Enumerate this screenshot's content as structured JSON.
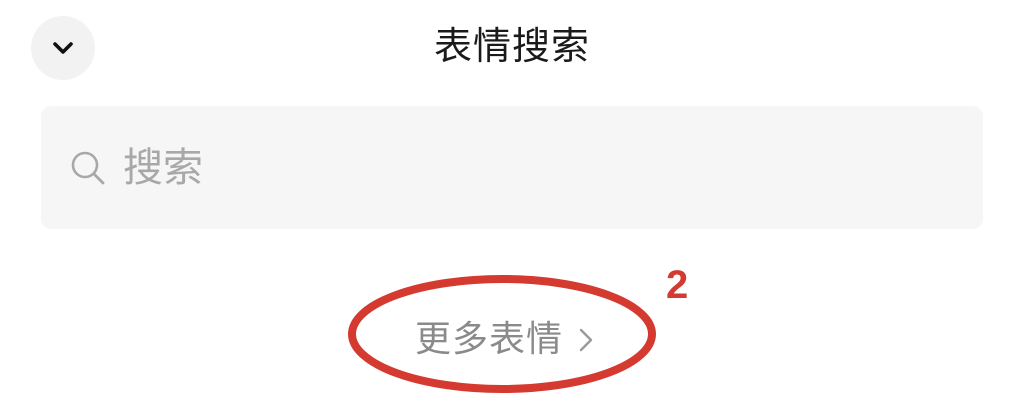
{
  "header": {
    "title": "表情搜索",
    "collapse_icon": "chevron-down-icon"
  },
  "search": {
    "placeholder": "搜索",
    "value": "",
    "icon": "search-icon"
  },
  "more": {
    "label": "更多表情",
    "icon": "chevron-right-icon"
  },
  "annotation": {
    "number": "2",
    "color": "#d43a2f"
  },
  "colors": {
    "title_text": "#1a1a1a",
    "search_background": "#f6f6f6",
    "placeholder_text": "#a8a8a8",
    "link_text": "#8a8a8a"
  }
}
